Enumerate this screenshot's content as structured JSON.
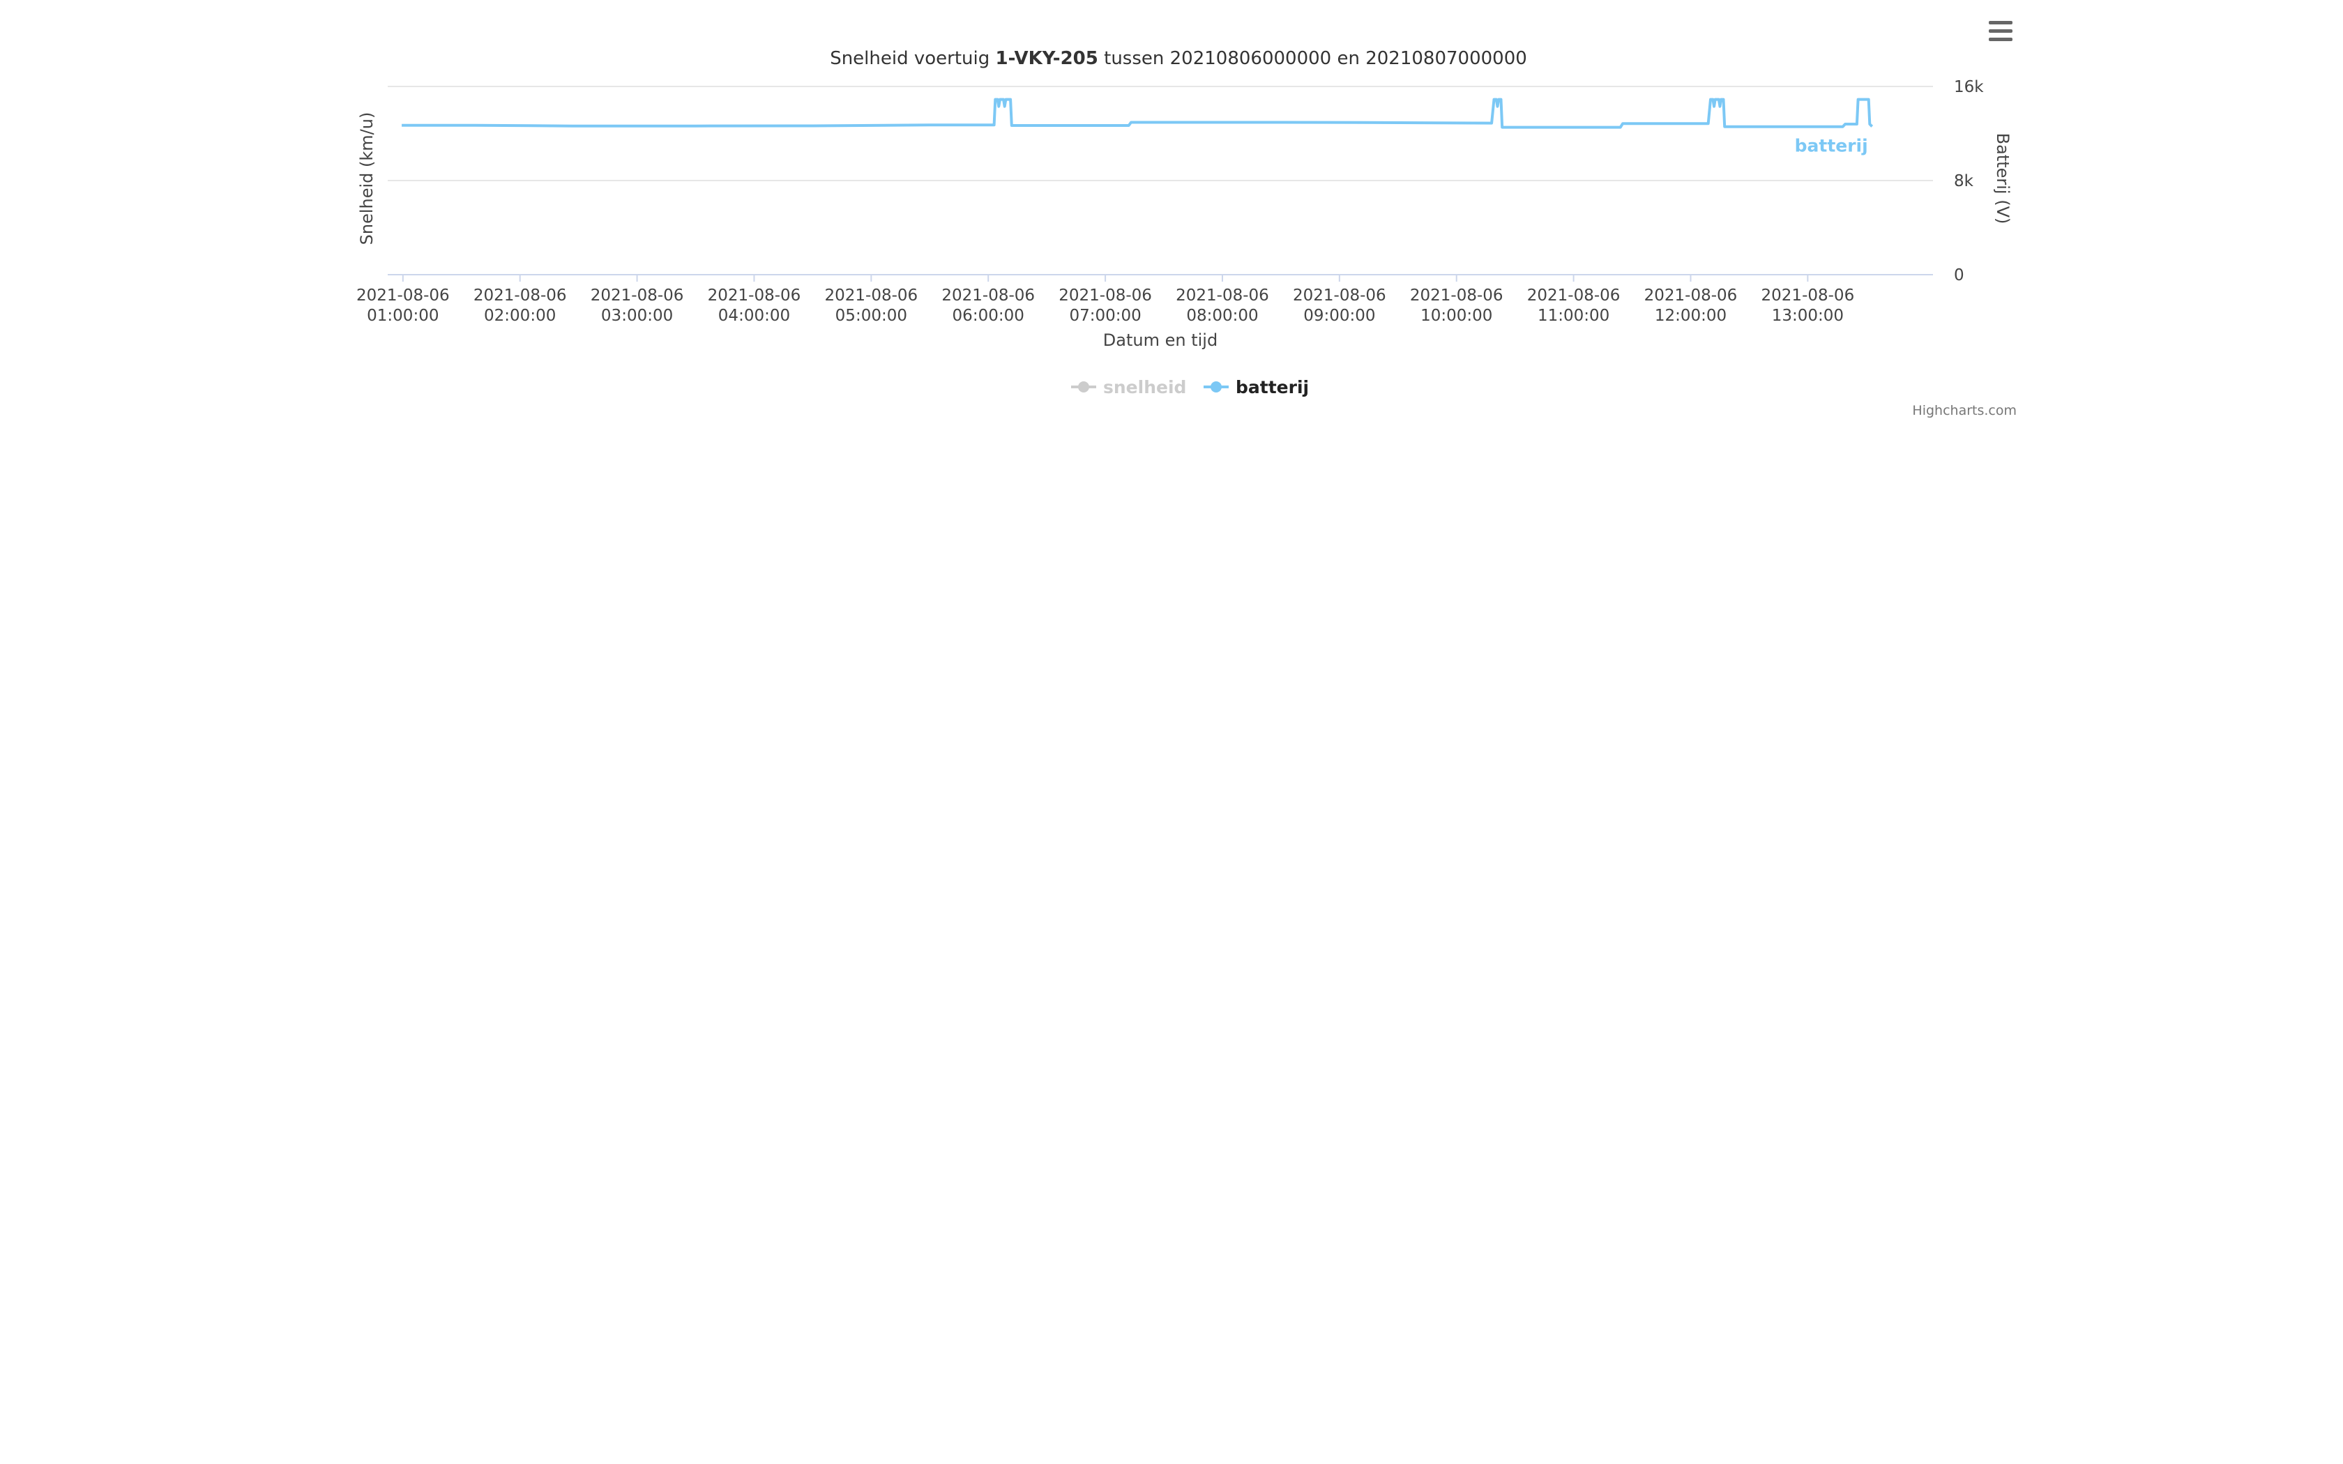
{
  "title": {
    "prefix": "Snelheid voertuig ",
    "vehicle": "1-VKY-205",
    "suffix": " tussen 20210806000000 en 20210807000000"
  },
  "menu": {
    "icon": "hamburger-menu-icon"
  },
  "credits": "Highcharts.com",
  "colors": {
    "batterij": "#7cc8f5",
    "snelheid_hidden": "#cccccc",
    "grid": "#e6e6e6",
    "axis_line": "#ccd6eb",
    "text": "#444444"
  },
  "chart_data": {
    "type": "line",
    "title": "Snelheid voertuig 1-VKY-205 tussen 20210806000000 en 20210807000000",
    "xlabel": "Datum en tijd",
    "ylabel_left": "Snelheid (km/u)",
    "ylabel_right": "Batterij (V)",
    "x_unit": "hours of 2021-08-06",
    "xlim": [
      0.87,
      14.07
    ],
    "ylim": [
      0,
      16000
    ],
    "x_ticks": [
      {
        "x": 1,
        "date": "2021-08-06",
        "time": "01:00:00"
      },
      {
        "x": 2,
        "date": "2021-08-06",
        "time": "02:00:00"
      },
      {
        "x": 3,
        "date": "2021-08-06",
        "time": "03:00:00"
      },
      {
        "x": 4,
        "date": "2021-08-06",
        "time": "04:00:00"
      },
      {
        "x": 5,
        "date": "2021-08-06",
        "time": "05:00:00"
      },
      {
        "x": 6,
        "date": "2021-08-06",
        "time": "06:00:00"
      },
      {
        "x": 7,
        "date": "2021-08-06",
        "time": "07:00:00"
      },
      {
        "x": 8,
        "date": "2021-08-06",
        "time": "08:00:00"
      },
      {
        "x": 9,
        "date": "2021-08-06",
        "time": "09:00:00"
      },
      {
        "x": 10,
        "date": "2021-08-06",
        "time": "10:00:00"
      },
      {
        "x": 11,
        "date": "2021-08-06",
        "time": "11:00:00"
      },
      {
        "x": 12,
        "date": "2021-08-06",
        "time": "12:00:00"
      },
      {
        "x": 13,
        "date": "2021-08-06",
        "time": "13:00:00"
      }
    ],
    "y_ticks": [
      {
        "value": 0,
        "label": "0"
      },
      {
        "value": 8000,
        "label": "8k"
      },
      {
        "value": 16000,
        "label": "16k"
      }
    ],
    "grid": true,
    "legend_placement": "bottom-center",
    "series": [
      {
        "name": "snelheid",
        "visible": false,
        "points": []
      },
      {
        "name": "batterij",
        "visible": true,
        "points": [
          [
            0.99,
            12700
          ],
          [
            1.62,
            12700
          ],
          [
            2.45,
            12640
          ],
          [
            3.5,
            12640
          ],
          [
            4.5,
            12650
          ],
          [
            5.5,
            12720
          ],
          [
            6.05,
            12720
          ],
          [
            6.06,
            14900
          ],
          [
            6.08,
            14900
          ],
          [
            6.09,
            14300
          ],
          [
            6.1,
            14900
          ],
          [
            6.13,
            14900
          ],
          [
            6.14,
            14300
          ],
          [
            6.15,
            14900
          ],
          [
            6.19,
            14900
          ],
          [
            6.2,
            12680
          ],
          [
            7.2,
            12680
          ],
          [
            7.22,
            12950
          ],
          [
            8.5,
            12950
          ],
          [
            9.2,
            12930
          ],
          [
            10.3,
            12880
          ],
          [
            10.32,
            14900
          ],
          [
            10.34,
            14900
          ],
          [
            10.35,
            14300
          ],
          [
            10.36,
            14900
          ],
          [
            10.38,
            14900
          ],
          [
            10.39,
            12530
          ],
          [
            11.4,
            12530
          ],
          [
            11.42,
            12850
          ],
          [
            12.15,
            12850
          ],
          [
            12.17,
            14900
          ],
          [
            12.19,
            14900
          ],
          [
            12.2,
            14300
          ],
          [
            12.21,
            14900
          ],
          [
            12.24,
            14900
          ],
          [
            12.25,
            14300
          ],
          [
            12.26,
            14900
          ],
          [
            12.28,
            14900
          ],
          [
            12.29,
            12580
          ],
          [
            13.3,
            12580
          ],
          [
            13.32,
            12800
          ],
          [
            13.42,
            12800
          ],
          [
            13.43,
            14900
          ],
          [
            13.52,
            14900
          ],
          [
            13.53,
            12800
          ],
          [
            13.55,
            12600
          ]
        ]
      }
    ]
  }
}
